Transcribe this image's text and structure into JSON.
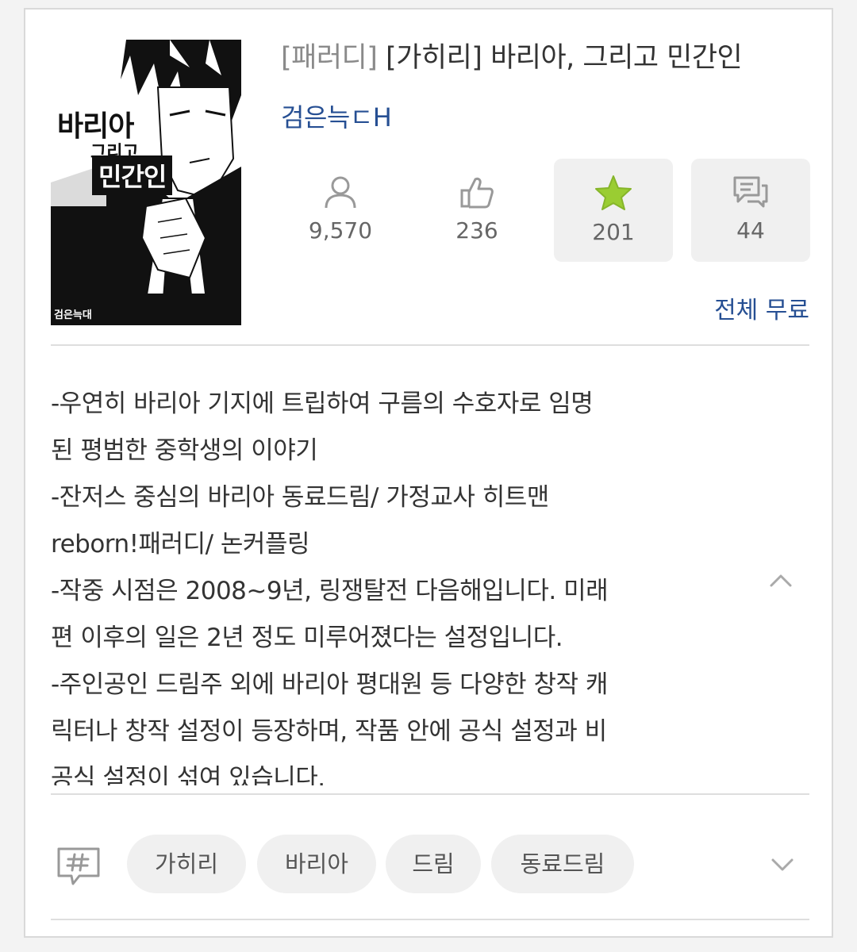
{
  "book": {
    "genre_tag": "[패러디]",
    "title_rest": " [가히리] 바리아, 그리고 민간인",
    "author": "검은늑ㄷH",
    "cover": {
      "title_line1": "바리아",
      "title_line2": "그리고",
      "title_line3": "민간인",
      "author": "검은늑대"
    }
  },
  "stats": {
    "views": {
      "icon": "person-icon",
      "value": "9,570"
    },
    "likes": {
      "icon": "thumbs-up-icon",
      "value": "236"
    },
    "favorites": {
      "icon": "star-icon",
      "value": "201",
      "color": "#9acd32"
    },
    "comments": {
      "icon": "comment-icon",
      "value": "44"
    }
  },
  "pricing": {
    "label": "전체 무료"
  },
  "synopsis": {
    "lines": [
      "-우연히 바리아 기지에 트립하여 구름의 수호자로 임명",
      "된  평범한 중학생의 이야기",
      "-잔저스 중심의 바리아 동료드림/ 가정교사 히트맨",
      "reborn!패러디/ 논커플링",
      "-작중 시점은 2008~9년, 링쟁탈전 다음해입니다. 미래",
      "편 이후의 일은 2년  정도 미루어졌다는 설정입니다.",
      "-주인공인 드림주 외에 바리아 평대원 등 다양한 창작 캐",
      "릭터나 창작 설정이 등장하며, 작품 안에 공식 설정과 비",
      "공식 설정이 섞여 있습니다."
    ]
  },
  "tags": [
    "가히리",
    "바리아",
    "드림",
    "동료드림"
  ],
  "colors": {
    "accent_blue": "#264f93",
    "star_green": "#9acd32",
    "chip_bg": "#f0f0f0"
  }
}
